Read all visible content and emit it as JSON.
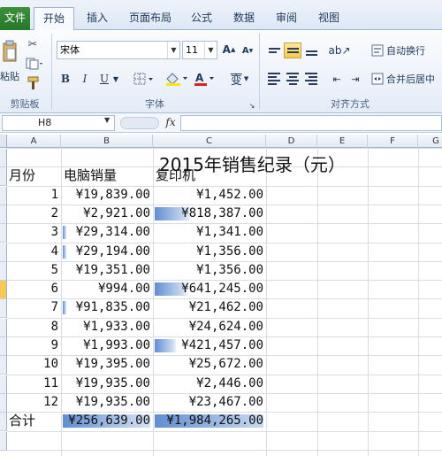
{
  "tabs": [
    "文件",
    "开始",
    "插入",
    "页面布局",
    "公式",
    "数据",
    "审阅",
    "视图"
  ],
  "ribbon": {
    "clipboard": {
      "paste_label": "粘贴",
      "group_label": "剪贴板"
    },
    "font": {
      "name": "宋体",
      "size": "11",
      "group_label": "字体",
      "bold": "B",
      "italic": "I",
      "underline": "U",
      "grow": "A",
      "shrink": "A",
      "phonetic": "变"
    },
    "alignment": {
      "wrap_label": "自动换行",
      "merge_label": "合并后居中",
      "group_label": "对齐方式"
    }
  },
  "formula_bar": {
    "name_box": "H8",
    "fx": "fx",
    "value": ""
  },
  "columns": [
    "A",
    "B",
    "C",
    "D",
    "E",
    "F",
    "G"
  ],
  "sheet": {
    "title": "2015年销售纪录（元）",
    "headers": {
      "month": "月份",
      "pc": "电脑销量",
      "copier": "复印机"
    },
    "rows": [
      {
        "month": "1",
        "pc": "¥19,839.00",
        "copier": "¥1,452.00",
        "pc_bar": 0.0,
        "copier_bar": 0.0
      },
      {
        "month": "2",
        "pc": "¥2,921.00",
        "copier": "¥818,387.00",
        "pc_bar": 0.0,
        "copier_bar": 0.33
      },
      {
        "month": "3",
        "pc": "¥29,314.00",
        "copier": "¥1,341.00",
        "pc_bar": 0.04,
        "copier_bar": 0.0
      },
      {
        "month": "4",
        "pc": "¥29,194.00",
        "copier": "¥1,356.00",
        "pc_bar": 0.04,
        "copier_bar": 0.0
      },
      {
        "month": "5",
        "pc": "¥19,351.00",
        "copier": "¥1,356.00",
        "pc_bar": 0.0,
        "copier_bar": 0.0
      },
      {
        "month": "6",
        "pc": "¥994.00",
        "copier": "¥641,245.00",
        "pc_bar": 0.0,
        "copier_bar": 0.3
      },
      {
        "month": "7",
        "pc": "¥91,835.00",
        "copier": "¥21,462.00",
        "pc_bar": 0.04,
        "copier_bar": 0.0
      },
      {
        "month": "8",
        "pc": "¥1,933.00",
        "copier": "¥24,624.00",
        "pc_bar": 0.0,
        "copier_bar": 0.0
      },
      {
        "month": "9",
        "pc": "¥1,993.00",
        "copier": "¥421,457.00",
        "pc_bar": 0.0,
        "copier_bar": 0.2
      },
      {
        "month": "10",
        "pc": "¥19,395.00",
        "copier": "¥25,672.00",
        "pc_bar": 0.0,
        "copier_bar": 0.0
      },
      {
        "month": "11",
        "pc": "¥19,935.00",
        "copier": "¥2,446.00",
        "pc_bar": 0.0,
        "copier_bar": 0.0
      },
      {
        "month": "12",
        "pc": "¥19,935.00",
        "copier": "¥23,467.00",
        "pc_bar": 0.0,
        "copier_bar": 0.0
      }
    ],
    "total": {
      "label": "合计",
      "pc": "¥256,639.00",
      "copier": "¥1,984,265.00",
      "pc_bar": 1.0,
      "copier_bar": 1.0
    },
    "selected_row": "6"
  },
  "colors": {
    "file_tab": "#2e8a32",
    "databar": "#5f8ed1",
    "selection": "#f7c855"
  }
}
